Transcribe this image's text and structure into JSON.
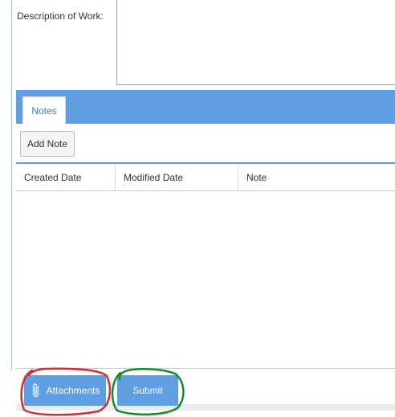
{
  "form": {
    "description_label": "Description of Work:",
    "description_value": ""
  },
  "notes": {
    "tab_label": "Notes",
    "add_note_label": "Add Note",
    "columns": [
      "Created Date",
      "Modified Date",
      "Note"
    ],
    "rows": []
  },
  "footer": {
    "attachments_label": "Attachments",
    "attachments_icon": "paperclip-icon",
    "submit_label": "Submit"
  },
  "colors": {
    "accent": "#5f9ee0",
    "annotation_red": "#d42a3a",
    "annotation_green": "#178a2e"
  }
}
